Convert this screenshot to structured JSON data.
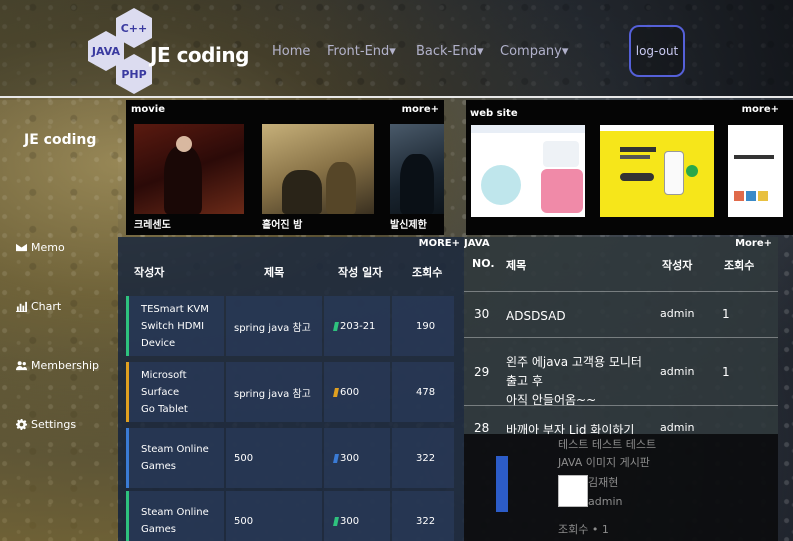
{
  "header": {
    "logo_hexes": [
      "C++",
      "JAVA",
      "PHP"
    ],
    "brand": "JE coding",
    "nav": [
      {
        "label": "Home"
      },
      {
        "label": "Front-End▾"
      },
      {
        "label": "Back-End▾"
      },
      {
        "label": "Company▾"
      }
    ],
    "logout_label": "log-out"
  },
  "sidebar": {
    "brand": "JE coding",
    "items": [
      {
        "label": "Memo",
        "icon": "envelope-icon"
      },
      {
        "label": "Chart",
        "icon": "bar-chart-icon"
      },
      {
        "label": "Membership",
        "icon": "users-icon"
      },
      {
        "label": "Settings",
        "icon": "gear-icon"
      }
    ]
  },
  "movie": {
    "title": "movie",
    "more": "more+",
    "items": [
      {
        "caption": "크레센도"
      },
      {
        "caption": "흩어진 밤"
      },
      {
        "caption": "발신제한"
      }
    ]
  },
  "website": {
    "title": "web site",
    "more": "more+"
  },
  "board_left": {
    "more": "MORE+",
    "headers": [
      "작성자",
      "제목",
      "작성 일자",
      "조회수"
    ],
    "rows": [
      {
        "name_line1": "TESmart KVM",
        "name_line2": "Switch HDMI Device",
        "title": "spring java 참고",
        "date": "203-21",
        "views": "190",
        "accent": "#2ec27e"
      },
      {
        "name_line1": "Microsoft Surface",
        "name_line2": "Go Tablet",
        "title": "spring java 참고",
        "date": "600",
        "views": "478",
        "accent": "#e0a020"
      },
      {
        "name_line1": "Steam Online",
        "name_line2": "Games",
        "title": "500",
        "date": "300",
        "views": "322",
        "accent": "#3a7bd5"
      },
      {
        "name_line1": "Steam Online",
        "name_line2": "Games",
        "title": "500",
        "date": "300",
        "views": "322",
        "accent": "#2ec27e"
      }
    ]
  },
  "board_right": {
    "label": "JAVA",
    "more": "More+",
    "headers": [
      "NO.",
      "제목",
      "작성자",
      "조회수"
    ],
    "rows": [
      {
        "no": "30",
        "title_line1": "ADSDSAD",
        "title_line2": "",
        "author": "admin",
        "views": "1"
      },
      {
        "no": "29",
        "title_line1": "왼주 에java 고객용 모니터 출고 후",
        "title_line2": "아직 안들어옴~~",
        "author": "admin",
        "views": "1"
      },
      {
        "no": "28",
        "title_line1": "바깨아 부자 Lid 화이하기",
        "title_line2": "",
        "author": "admin",
        "views": ""
      }
    ]
  },
  "gallery": {
    "lines": [
      "테스트 테스트 테스트",
      "JAVA 이미지 게시판"
    ],
    "writer": "김재현",
    "role": "admin",
    "views": "조회수 • 1"
  }
}
